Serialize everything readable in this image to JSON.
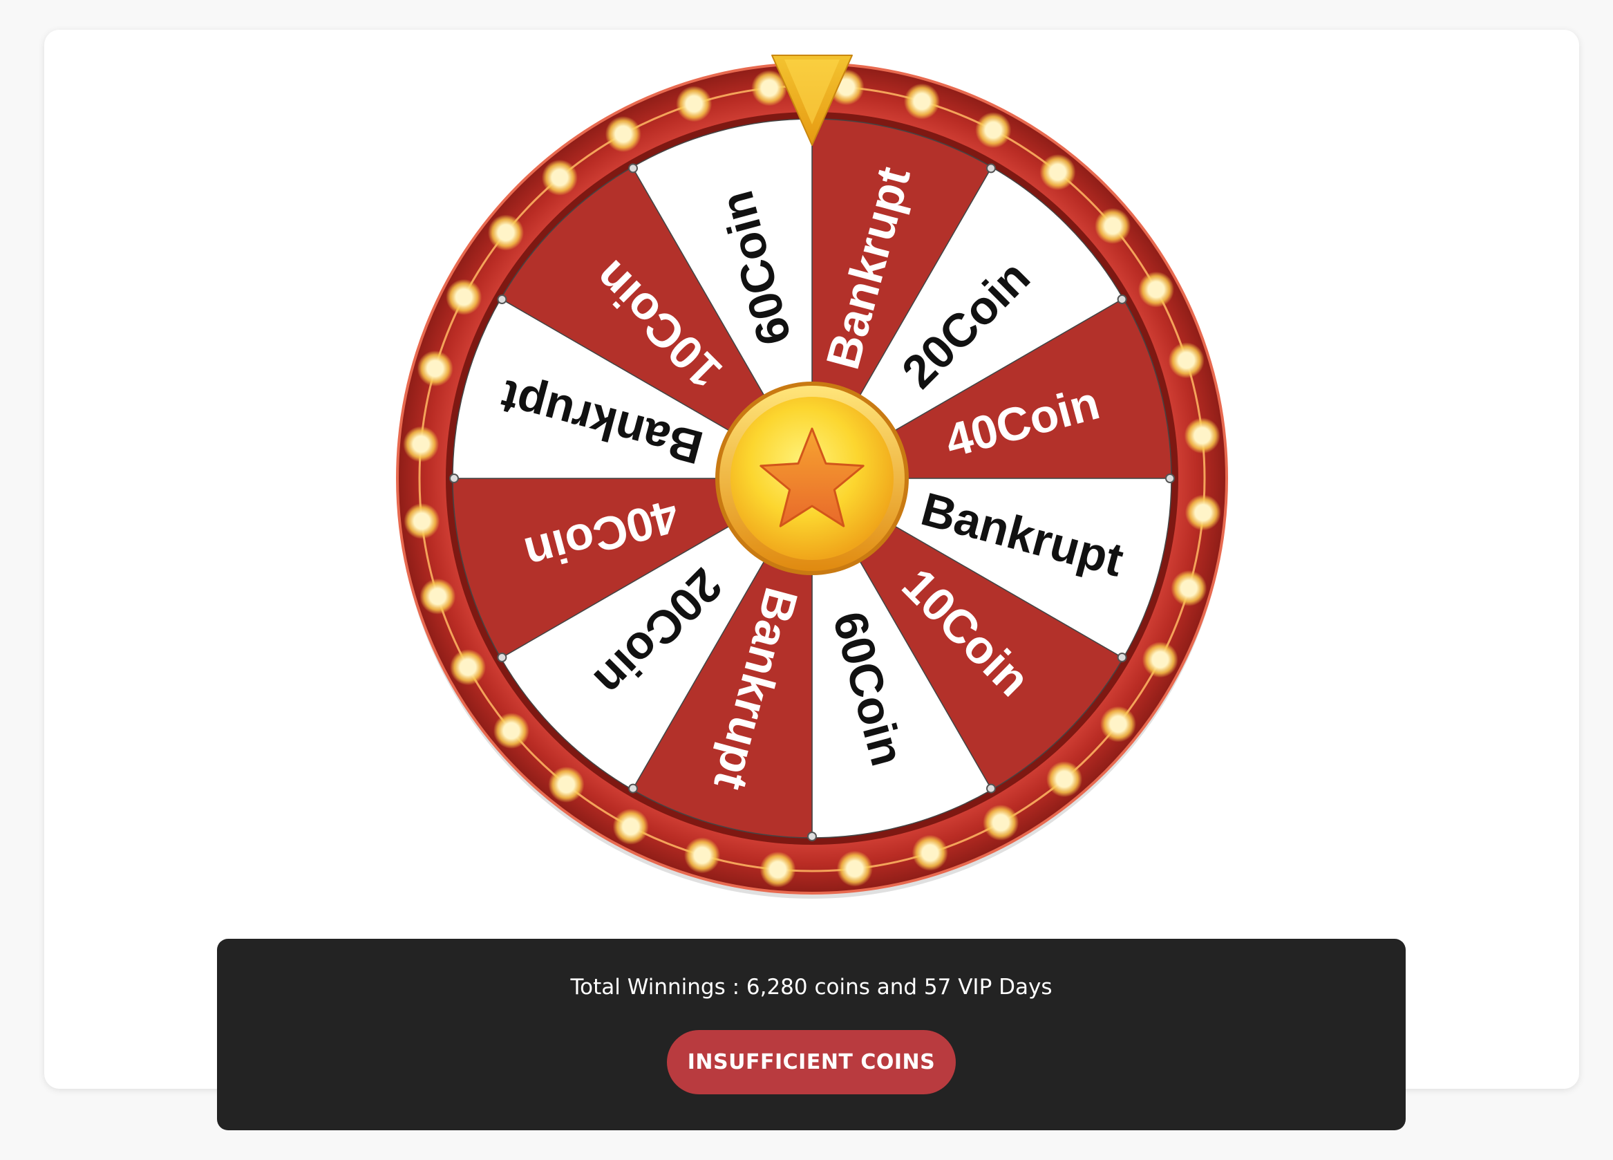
{
  "wheel": {
    "segments": [
      {
        "label": "Bankrupt",
        "color": "red"
      },
      {
        "label": "20Coin",
        "color": "white"
      },
      {
        "label": "40Coin",
        "color": "red"
      },
      {
        "label": "Bankrupt",
        "color": "white"
      },
      {
        "label": "10Coin",
        "color": "red"
      },
      {
        "label": "60Coin",
        "color": "white"
      },
      {
        "label": "Bankrupt",
        "color": "red"
      },
      {
        "label": "20Coin",
        "color": "white"
      },
      {
        "label": "40Coin",
        "color": "red"
      },
      {
        "label": "Bankrupt",
        "color": "white"
      },
      {
        "label": "10Coin",
        "color": "red"
      },
      {
        "label": "60Coin",
        "color": "white"
      }
    ],
    "center_icon": "star-icon",
    "pointer_icon": "pointer-icon",
    "colors": {
      "segment_red": "#b3312a",
      "segment_white": "#ffffff",
      "rim": "#c2352b",
      "bulb": "#fff4c8",
      "gold": "#f6b61e",
      "text_on_red": "#ffffff",
      "text_on_white": "#111111"
    }
  },
  "summary": {
    "winnings_text": "Total Winnings : 6,280 coins and 57 VIP Days"
  },
  "actions": {
    "spin_label": "INSUFFICIENT COINS",
    "spin_color": "#b93b3f"
  }
}
